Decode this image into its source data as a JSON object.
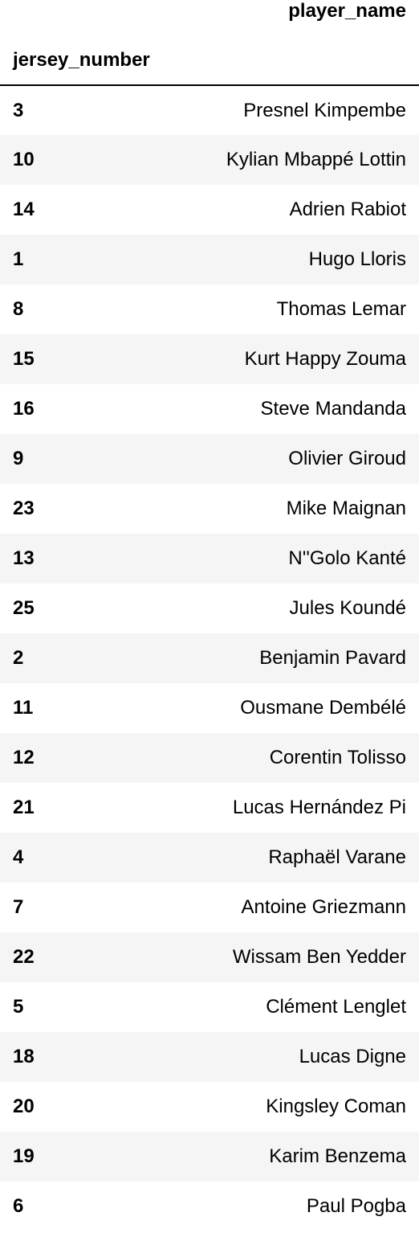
{
  "table": {
    "value_column_header": "player_name",
    "index_header": "jersey_number",
    "rows": [
      {
        "jersey_number": "3",
        "player_name": "Presnel Kimpembe"
      },
      {
        "jersey_number": "10",
        "player_name": "Kylian Mbappé Lottin"
      },
      {
        "jersey_number": "14",
        "player_name": "Adrien Rabiot"
      },
      {
        "jersey_number": "1",
        "player_name": "Hugo Lloris"
      },
      {
        "jersey_number": "8",
        "player_name": "Thomas Lemar"
      },
      {
        "jersey_number": "15",
        "player_name": "Kurt Happy Zouma"
      },
      {
        "jersey_number": "16",
        "player_name": "Steve Mandanda"
      },
      {
        "jersey_number": "9",
        "player_name": "Olivier Giroud"
      },
      {
        "jersey_number": "23",
        "player_name": "Mike Maignan"
      },
      {
        "jersey_number": "13",
        "player_name": "N''Golo Kanté"
      },
      {
        "jersey_number": "25",
        "player_name": "Jules Koundé"
      },
      {
        "jersey_number": "2",
        "player_name": "Benjamin Pavard"
      },
      {
        "jersey_number": "11",
        "player_name": "Ousmane Dembélé"
      },
      {
        "jersey_number": "12",
        "player_name": "Corentin Tolisso"
      },
      {
        "jersey_number": "21",
        "player_name": "Lucas Hernández Pi"
      },
      {
        "jersey_number": "4",
        "player_name": "Raphaël Varane"
      },
      {
        "jersey_number": "7",
        "player_name": "Antoine Griezmann"
      },
      {
        "jersey_number": "22",
        "player_name": "Wissam Ben Yedder"
      },
      {
        "jersey_number": "5",
        "player_name": "Clément Lenglet"
      },
      {
        "jersey_number": "18",
        "player_name": "Lucas Digne"
      },
      {
        "jersey_number": "20",
        "player_name": "Kingsley Coman"
      },
      {
        "jersey_number": "19",
        "player_name": "Karim Benzema"
      },
      {
        "jersey_number": "6",
        "player_name": "Paul Pogba"
      }
    ]
  }
}
